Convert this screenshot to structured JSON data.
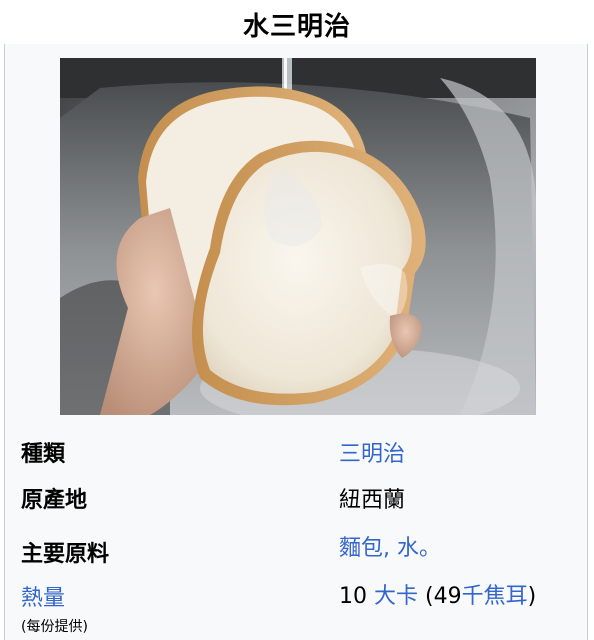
{
  "title": "水三明治",
  "image": {
    "alt": "Hand holding two slices of white bread under a running faucet over a steel sink"
  },
  "rows": [
    {
      "label": "種類",
      "value": "三明治"
    },
    {
      "label": "原產地",
      "value": "紐西蘭"
    },
    {
      "label": "主要原料",
      "value": "麵包, 水。"
    },
    {
      "label": "熱量",
      "note": "(每份提供)",
      "value_number": "10 ",
      "value_unit": "大卡",
      "value_paren_open": " (",
      "value_kj_number": "49",
      "value_kj_unit": "千焦耳",
      "value_paren_close": ")"
    }
  ],
  "colors": {
    "link": "#3366cc",
    "text": "#000000",
    "box_bg": "#f8f9fa"
  }
}
